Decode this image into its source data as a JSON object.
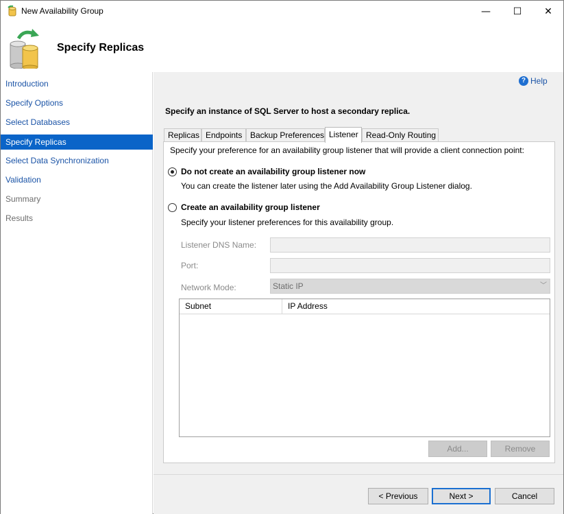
{
  "window": {
    "title": "New Availability Group",
    "minimize": "—",
    "maximize": "☐",
    "close": "✕"
  },
  "header": {
    "title": "Specify Replicas"
  },
  "nav": {
    "items": [
      {
        "label": "Introduction",
        "state": "link"
      },
      {
        "label": "Specify Options",
        "state": "link"
      },
      {
        "label": "Select Databases",
        "state": "link"
      },
      {
        "label": "Specify Replicas",
        "state": "selected"
      },
      {
        "label": "Select Data Synchronization",
        "state": "link"
      },
      {
        "label": "Validation",
        "state": "link"
      },
      {
        "label": "Summary",
        "state": "disabled"
      },
      {
        "label": "Results",
        "state": "disabled"
      }
    ]
  },
  "main": {
    "help": "Help",
    "instruction": "Specify an instance of SQL Server to host a secondary replica.",
    "tabs": [
      {
        "label": "Replicas"
      },
      {
        "label": "Endpoints"
      },
      {
        "label": "Backup Preferences"
      },
      {
        "label": "Listener",
        "active": true
      },
      {
        "label": "Read-Only Routing"
      }
    ],
    "listener": {
      "description": "Specify your preference for an availability group listener that will provide a client connection point:",
      "option_none": {
        "label": "Do not create an availability group listener now",
        "subtext": "You can create the listener later using the Add Availability Group Listener dialog.",
        "checked": true
      },
      "option_create": {
        "label": "Create an availability group listener",
        "subtext": "Specify your listener preferences for this availability group.",
        "checked": false
      },
      "dns_name_label": "Listener DNS Name:",
      "dns_name_value": "",
      "port_label": "Port:",
      "port_value": "",
      "network_mode_label": "Network Mode:",
      "network_mode_value": "Static IP",
      "grid_columns": [
        "Subnet",
        "IP Address"
      ],
      "add_button": "Add...",
      "remove_button": "Remove"
    }
  },
  "footer": {
    "previous": "< Previous",
    "next": "Next >",
    "cancel": "Cancel"
  },
  "colors": {
    "nav_link": "#1a53a6",
    "nav_selected_bg": "#0a64c8",
    "panel_bg": "#f0f0f0",
    "default_button_border": "#1a6fd1"
  }
}
